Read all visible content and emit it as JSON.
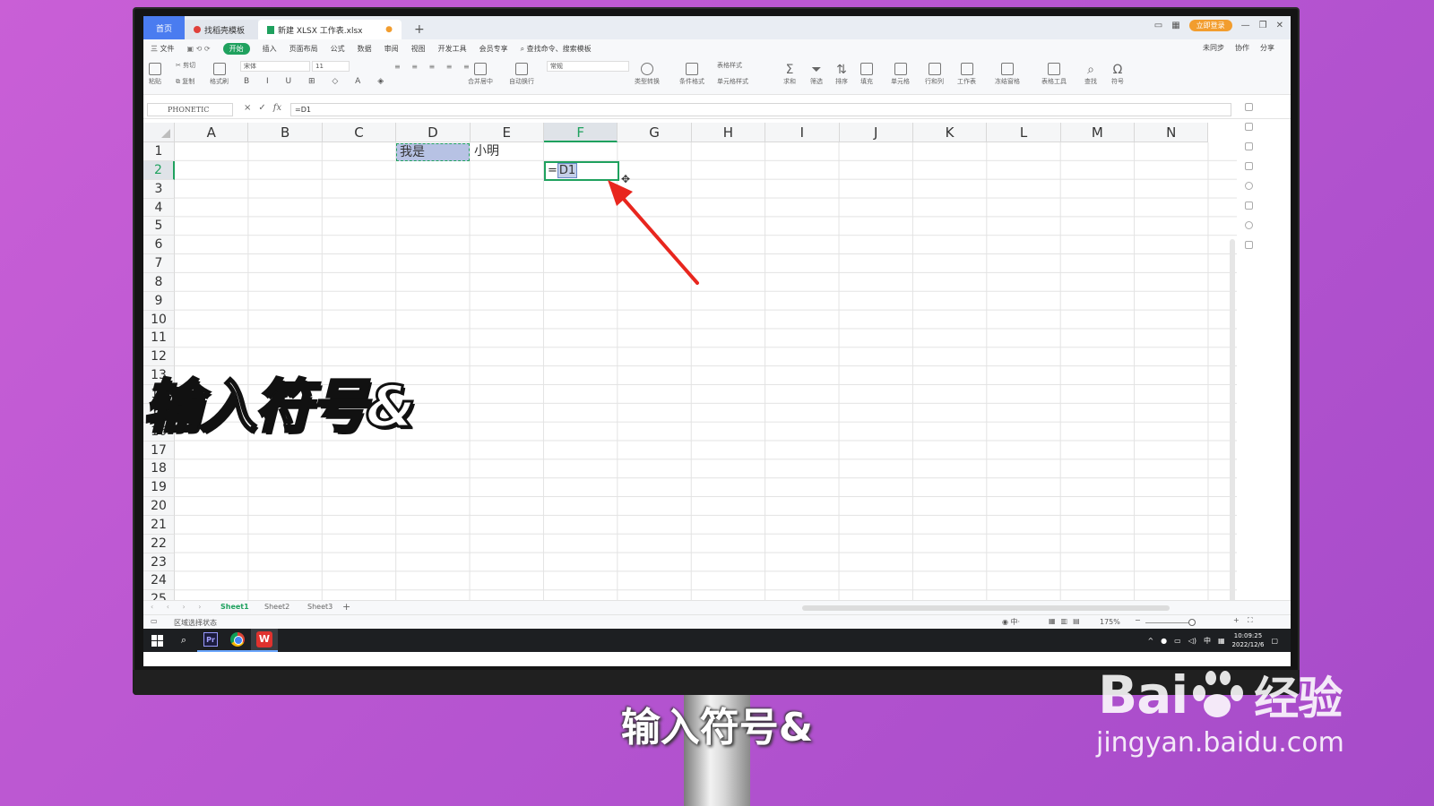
{
  "tabs": {
    "home": "首页",
    "template": "找稻壳模板",
    "doc": "新建 XLSX 工作表.xlsx",
    "add": "+"
  },
  "titlebar": {
    "login": "立即登录"
  },
  "menu": {
    "items": [
      "三 文件",
      "开始",
      "插入",
      "页面布局",
      "公式",
      "数据",
      "审阅",
      "视图",
      "开发工具",
      "会员专享"
    ],
    "search_placeholder": "查找命令、搜索模板",
    "right": [
      "未同步",
      "协作",
      "分享"
    ]
  },
  "ribbon": {
    "paste": "粘贴",
    "cut": "剪切",
    "copy": "复制",
    "format_painter": "格式刷",
    "font_name": "宋体",
    "font_size": "11",
    "merge": "合并居中",
    "wrap": "自动换行",
    "number_format": "常规",
    "type_convert": "类型转换",
    "cond_format": "条件格式",
    "table_style": "表格样式",
    "cell_style": "单元格样式",
    "sum": "求和",
    "filter": "筛选",
    "sort": "排序",
    "fill": "填充",
    "cell": "单元格",
    "row_col": "行和列",
    "sheet": "工作表",
    "freeze": "冻结窗格",
    "table_tools": "表格工具",
    "find": "查找",
    "symbol": "符号"
  },
  "formula_bar": {
    "name_box": "PHONETIC",
    "icons": [
      "×",
      "✓",
      "fx"
    ],
    "formula": "=D1"
  },
  "grid": {
    "columns": [
      "A",
      "B",
      "C",
      "D",
      "E",
      "F",
      "G",
      "H",
      "I",
      "J",
      "K",
      "L",
      "M",
      "N"
    ],
    "selected_column": "F",
    "rows": [
      "1",
      "2",
      "3",
      "4",
      "5",
      "6",
      "7",
      "8",
      "9",
      "10",
      "11",
      "12",
      "13",
      "14",
      "15",
      "16",
      "17",
      "18",
      "19",
      "20",
      "21",
      "22",
      "23",
      "24",
      "25"
    ],
    "selected_row": "2",
    "cells": {
      "D1": "我是",
      "E1": "小明",
      "F2_prefix": "=",
      "F2_ref": "D1"
    }
  },
  "sheets": [
    "Sheet1",
    "Sheet2",
    "Sheet3"
  ],
  "active_sheet": "Sheet1",
  "status": {
    "mode": "区域选择状态",
    "zoom": "175%"
  },
  "taskbar": {
    "ime": "中",
    "time": "10:09:25",
    "date": "2022/12/6"
  },
  "overlay": {
    "big_text": "输入符号&",
    "caption": "输入符号&"
  },
  "watermark": {
    "brand_a": "Bai",
    "brand_b": "经验",
    "url": "jingyan.baidu.com"
  },
  "colors": {
    "accent_green": "#1fa15e",
    "arrow_red": "#e8261e",
    "background_purple": "#c95fd6",
    "home_tab_blue": "#4a7cf0"
  }
}
